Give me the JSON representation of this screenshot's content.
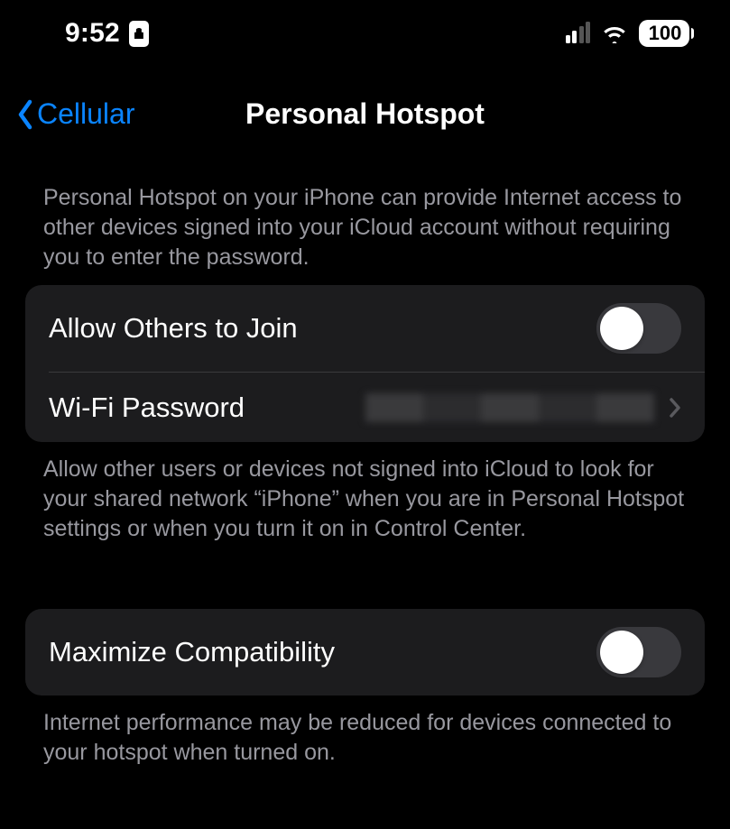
{
  "status": {
    "time": "9:52",
    "battery": "100"
  },
  "nav": {
    "back_label": "Cellular",
    "title": "Personal Hotspot"
  },
  "sections": {
    "intro": "Personal Hotspot on your iPhone can provide Internet access to other devices signed into your iCloud account without requiring you to enter the password.",
    "group1": {
      "allow_others": {
        "label": "Allow Others to Join",
        "on": false
      },
      "wifi_password": {
        "label": "Wi-Fi Password",
        "value": ""
      }
    },
    "group1_footer": "Allow other users or devices not signed into iCloud to look for your shared network “iPhone” when you are in Personal Hotspot settings or when you turn it on in Control Center.",
    "group2": {
      "maximize_compat": {
        "label": "Maximize Compatibility",
        "on": false
      }
    },
    "group2_footer": "Internet performance may be reduced for devices connected to your hotspot when turned on."
  }
}
